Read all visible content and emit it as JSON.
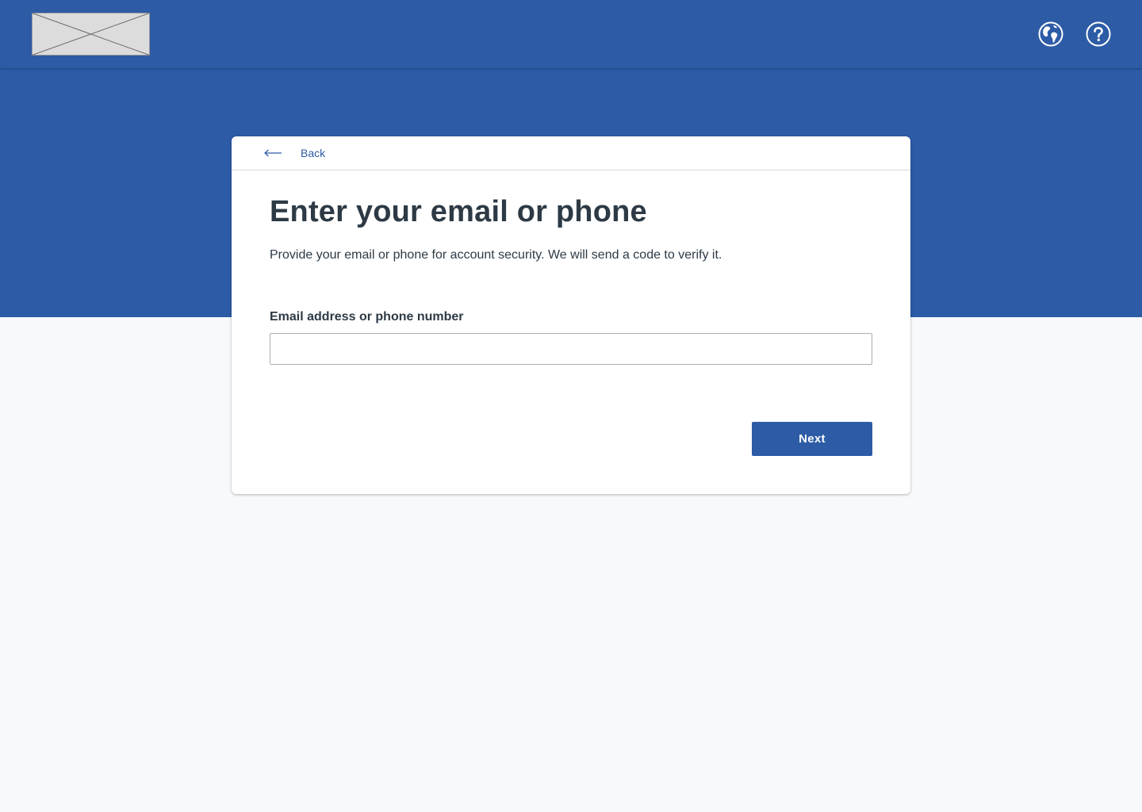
{
  "header": {
    "logo_icon": "logo-placeholder-icon",
    "globe_icon": "globe-icon",
    "help_icon": "help-icon"
  },
  "card": {
    "back_label": "Back",
    "back_icon": "arrow-left-icon",
    "title": "Enter your email or phone",
    "subtitle": "Provide your email or phone for account security. We will send a code to verify it.",
    "field_label": "Email address or phone number",
    "field_value": "",
    "field_placeholder": "",
    "next_label": "Next"
  },
  "colors": {
    "brand": "#2d5ba6",
    "text": "#2d3a45",
    "page_background": "#f8f9fb",
    "card_background": "#ffffff"
  }
}
